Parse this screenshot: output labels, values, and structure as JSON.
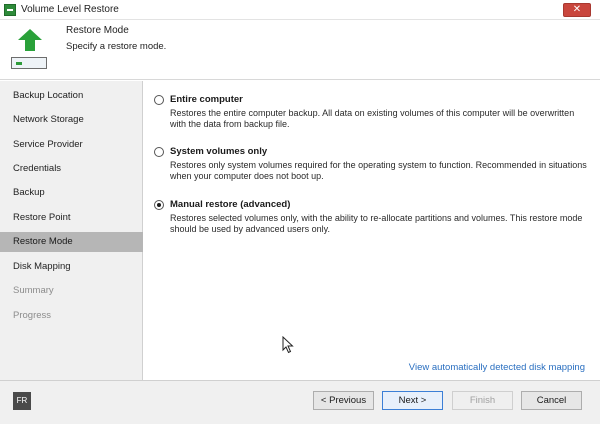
{
  "window": {
    "title": "Volume Level Restore",
    "close_label": "✕"
  },
  "header": {
    "title": "Restore Mode",
    "subtitle": "Specify a restore mode."
  },
  "sidebar": {
    "items": [
      {
        "label": "Backup Location",
        "state": "normal"
      },
      {
        "label": "Network Storage",
        "state": "normal"
      },
      {
        "label": "Service Provider",
        "state": "normal"
      },
      {
        "label": "Credentials",
        "state": "normal"
      },
      {
        "label": "Backup",
        "state": "normal"
      },
      {
        "label": "Restore Point",
        "state": "normal"
      },
      {
        "label": "Restore Mode",
        "state": "active"
      },
      {
        "label": "Disk Mapping",
        "state": "normal"
      },
      {
        "label": "Summary",
        "state": "disabled"
      },
      {
        "label": "Progress",
        "state": "disabled"
      }
    ]
  },
  "options": [
    {
      "label": "Entire computer",
      "description": "Restores the entire computer backup. All data on existing volumes of this computer will be overwritten with the data from backup file.",
      "selected": false
    },
    {
      "label": "System volumes only",
      "description": "Restores only system volumes required for the operating system to function. Recommended in situations when your computer does not boot up.",
      "selected": false
    },
    {
      "label": "Manual restore (advanced)",
      "description": "Restores selected volumes only, with the ability to re-allocate partitions and volumes. This restore mode should be used by advanced users only.",
      "selected": true
    }
  ],
  "link": {
    "label": "View automatically detected disk mapping"
  },
  "footer": {
    "language": "FR",
    "previous_label": "< Previous",
    "next_label": "Next >",
    "finish_label": "Finish",
    "cancel_label": "Cancel"
  },
  "colors": {
    "accent_link": "#2a6fc0",
    "active_nav": "#b6b6b6",
    "close_button": "#c9463d"
  }
}
